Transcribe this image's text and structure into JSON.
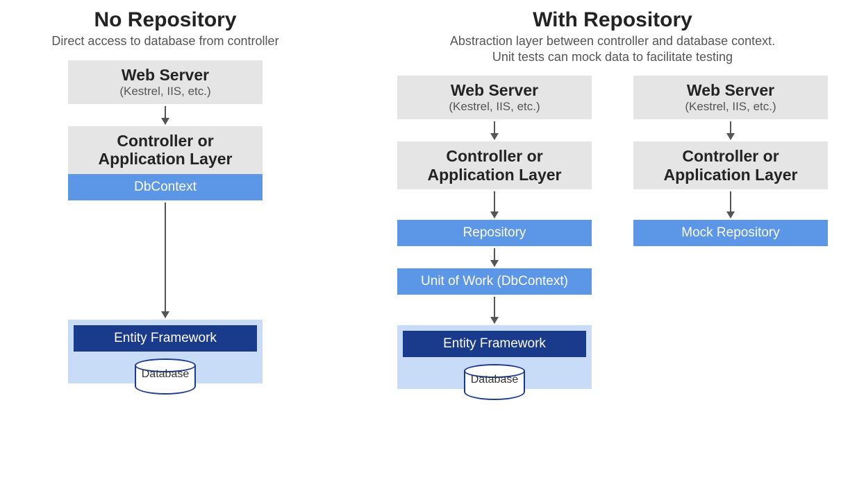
{
  "left": {
    "title": "No Repository",
    "subtitle": "Direct access to database from controller",
    "webserver_title": "Web Server",
    "webserver_sub": "(Kestrel, IIS, etc.)",
    "controller_line1": "Controller or",
    "controller_line2": "Application Layer",
    "dbcontext": "DbContext",
    "ef": "Entity Framework",
    "database": "Database"
  },
  "right": {
    "title": "With Repository",
    "subtitle_line1": "Abstraction layer between controller and database context.",
    "subtitle_line2": "Unit tests can mock data to facilitate testing",
    "colA": {
      "webserver_title": "Web Server",
      "webserver_sub": "(Kestrel, IIS, etc.)",
      "controller_line1": "Controller or",
      "controller_line2": "Application Layer",
      "repository": "Repository",
      "uow": "Unit of Work (DbContext)",
      "ef": "Entity Framework",
      "database": "Database"
    },
    "colB": {
      "webserver_title": "Web Server",
      "webserver_sub": "(Kestrel, IIS, etc.)",
      "controller_line1": "Controller or",
      "controller_line2": "Application Layer",
      "mock_repo": "Mock Repository"
    }
  }
}
